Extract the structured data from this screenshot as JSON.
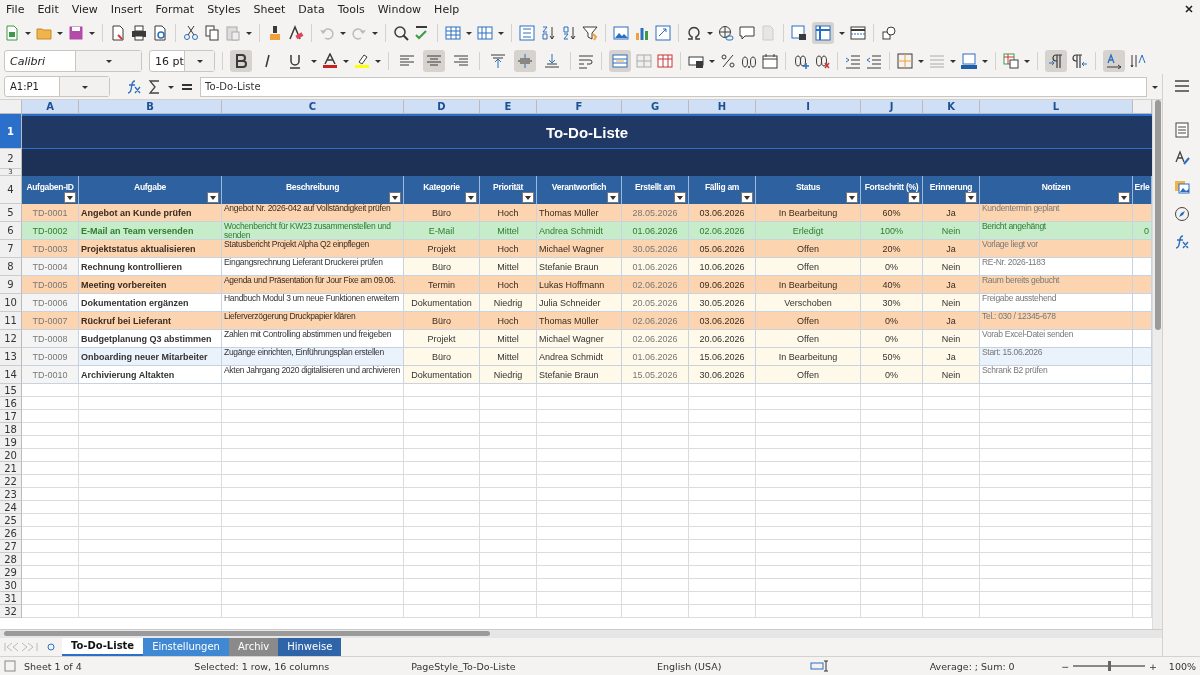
{
  "menu": [
    "File",
    "Edit",
    "View",
    "Insert",
    "Format",
    "Styles",
    "Sheet",
    "Data",
    "Tools",
    "Window",
    "Help"
  ],
  "formatting": {
    "font": "Calibri",
    "size": "16 pt",
    "bold": true,
    "italic": false,
    "underline": false,
    "align_left": false,
    "align_center": true,
    "align_right": false,
    "valign_top": false,
    "valign_middle": true,
    "valign_bottom": false,
    "merged": true
  },
  "formula_bar": {
    "name_box": "A1:P1",
    "content": "To-Do-Liste"
  },
  "column_letters": [
    {
      "label": "A",
      "selected": true
    },
    {
      "label": "B",
      "selected": true
    },
    {
      "label": "C",
      "selected": true
    },
    {
      "label": "D",
      "selected": true
    },
    {
      "label": "E",
      "selected": true
    },
    {
      "label": "F",
      "selected": true
    },
    {
      "label": "G",
      "selected": true
    },
    {
      "label": "H",
      "selected": true
    },
    {
      "label": "I",
      "selected": true
    },
    {
      "label": "J",
      "selected": true
    },
    {
      "label": "K",
      "selected": true
    },
    {
      "label": "L",
      "selected": true
    }
  ],
  "title_row": {
    "number": "1",
    "selected": true,
    "title": "To-Do-Liste"
  },
  "band_rows": [
    "2",
    "3"
  ],
  "header_row": {
    "number": "4",
    "columns": [
      {
        "label": "Aufgaben-ID",
        "filter": true
      },
      {
        "label": "Aufgabe",
        "filter": true
      },
      {
        "label": "Beschreibung",
        "filter": true
      },
      {
        "label": "Kategorie",
        "filter": true
      },
      {
        "label": "Priorität",
        "filter": true
      },
      {
        "label": "Verantwortlich",
        "filter": true
      },
      {
        "label": "Erstellt am",
        "filter": true
      },
      {
        "label": "Fällig am",
        "filter": true
      },
      {
        "label": "Status",
        "filter": true
      },
      {
        "label": "Fortschritt (%)",
        "filter": true
      },
      {
        "label": "Erinnerung",
        "filter": true
      },
      {
        "label": "Notizen",
        "filter": true
      },
      {
        "label": "Erle",
        "filter": false
      }
    ]
  },
  "rows": [
    {
      "number": "5",
      "kind": "high",
      "cells": [
        "TD-0001",
        "Angebot an Kunde prüfen",
        "Angebot Nr. 2026-042 auf Vollständigkeit prüfen",
        "Büro",
        "Hoch",
        "Thomas Müller",
        "28.05.2026",
        "03.06.2026",
        "In Bearbeitung",
        "60%",
        "Ja",
        "Kundentermin geplant"
      ]
    },
    {
      "number": "6",
      "kind": "done",
      "cells": [
        "TD-0002",
        "E-Mail an Team versenden",
        "Wochenbericht für KW23 zusammenstellen und senden",
        "E-Mail",
        "Mittel",
        "Andrea Schmidt",
        "01.06.2026",
        "02.06.2026",
        "Erledigt",
        "100%",
        "Nein",
        "Bericht angehängt"
      ],
      "column_13": "0"
    },
    {
      "number": "7",
      "kind": "high",
      "cells": [
        "TD-0003",
        "Projektstatus aktualisieren",
        "Statusbericht Projekt Alpha Q2 einpflegen",
        "Projekt",
        "Hoch",
        "Michael Wagner",
        "30.05.2026",
        "05.06.2026",
        "Offen",
        "20%",
        "Ja",
        "Vorlage liegt vor"
      ]
    },
    {
      "number": "8",
      "kind": "normal",
      "cells": [
        "TD-0004",
        "Rechnung kontrollieren",
        "Eingangsrechnung Lieferant Druckerei prüfen",
        "Büro",
        "Mittel",
        "Stefanie Braun",
        "01.06.2026",
        "10.06.2026",
        "Offen",
        "0%",
        "Nein",
        "RE-Nr. 2026-1183"
      ]
    },
    {
      "number": "9",
      "kind": "high",
      "cells": [
        "TD-0005",
        "Meeting vorbereiten",
        "Agenda und Präsentation für Jour Fixe am 09.06.",
        "Termin",
        "Hoch",
        "Lukas Hoffmann",
        "02.06.2026",
        "09.06.2026",
        "In Bearbeitung",
        "40%",
        "Ja",
        "Raum bereits gebucht"
      ]
    },
    {
      "number": "10",
      "kind": "normal",
      "cells": [
        "TD-0006",
        "Dokumentation ergänzen",
        "Handbuch Modul 3 um neue Funktionen erweitern",
        "Dokumentation",
        "Niedrig",
        "Julia Schneider",
        "20.05.2026",
        "30.05.2026",
        "Verschoben",
        "30%",
        "Nein",
        "Freigabe ausstehend"
      ]
    },
    {
      "number": "11",
      "kind": "high",
      "cells": [
        "TD-0007",
        "Rückruf bei Lieferant",
        "Lieferverzögerung Druckpapier klären",
        "Büro",
        "Hoch",
        "Thomas Müller",
        "02.06.2026",
        "03.06.2026",
        "Offen",
        "0%",
        "Ja",
        "Tel.: 030 / 12345-678"
      ]
    },
    {
      "number": "12",
      "kind": "normal",
      "cells": [
        "TD-0008",
        "Budgetplanung Q3 abstimmen",
        "Zahlen mit Controlling abstimmen und freigeben",
        "Projekt",
        "Mittel",
        "Michael Wagner",
        "02.06.2026",
        "20.06.2026",
        "Offen",
        "0%",
        "Nein",
        "Vorab Excel-Datei senden"
      ]
    },
    {
      "number": "13",
      "kind": "active",
      "cells": [
        "TD-0009",
        "Onboarding neuer Mitarbeiter",
        "Zugänge einrichten, Einführungsplan erstellen",
        "Büro",
        "Mittel",
        "Andrea Schmidt",
        "01.06.2026",
        "15.06.2026",
        "In Bearbeitung",
        "50%",
        "Ja",
        "Start: 15.06.2026"
      ]
    },
    {
      "number": "14",
      "kind": "normal",
      "cells": [
        "TD-0010",
        "Archivierung Altakten",
        "Akten Jahrgang 2020 digitalisieren und archivieren",
        "Dokumentation",
        "Niedrig",
        "Stefanie Braun",
        "15.05.2026",
        "30.06.2026",
        "Offen",
        "0%",
        "Nein",
        "Schrank B2 prüfen"
      ]
    }
  ],
  "empty_rows": [
    "15",
    "16",
    "17",
    "18",
    "19",
    "20",
    "21",
    "22",
    "23",
    "24",
    "25",
    "26",
    "27",
    "28",
    "29",
    "30",
    "31",
    "32"
  ],
  "sheet_tabs": [
    {
      "label": "To-Do-Liste",
      "selected": true
    },
    {
      "label": "Einstellungen",
      "selected": false,
      "color": "#3f88d4"
    },
    {
      "label": "Archiv",
      "selected": false,
      "color": "#8a8a8a"
    },
    {
      "label": "Hinweise",
      "selected": false,
      "color": "#2f65a8"
    }
  ],
  "status_bar": {
    "sheet": "Sheet 1 of 4",
    "selection": "Selected: 1 row, 16 columns",
    "page_style": "PageStyle_To-Do-Liste",
    "language": "English (USA)",
    "summary": "Average: ; Sum: 0",
    "zoom_minus": "−",
    "zoom_plus": "+",
    "zoom": {
      "level": 0.5
    },
    "zoom_text": "100%"
  }
}
